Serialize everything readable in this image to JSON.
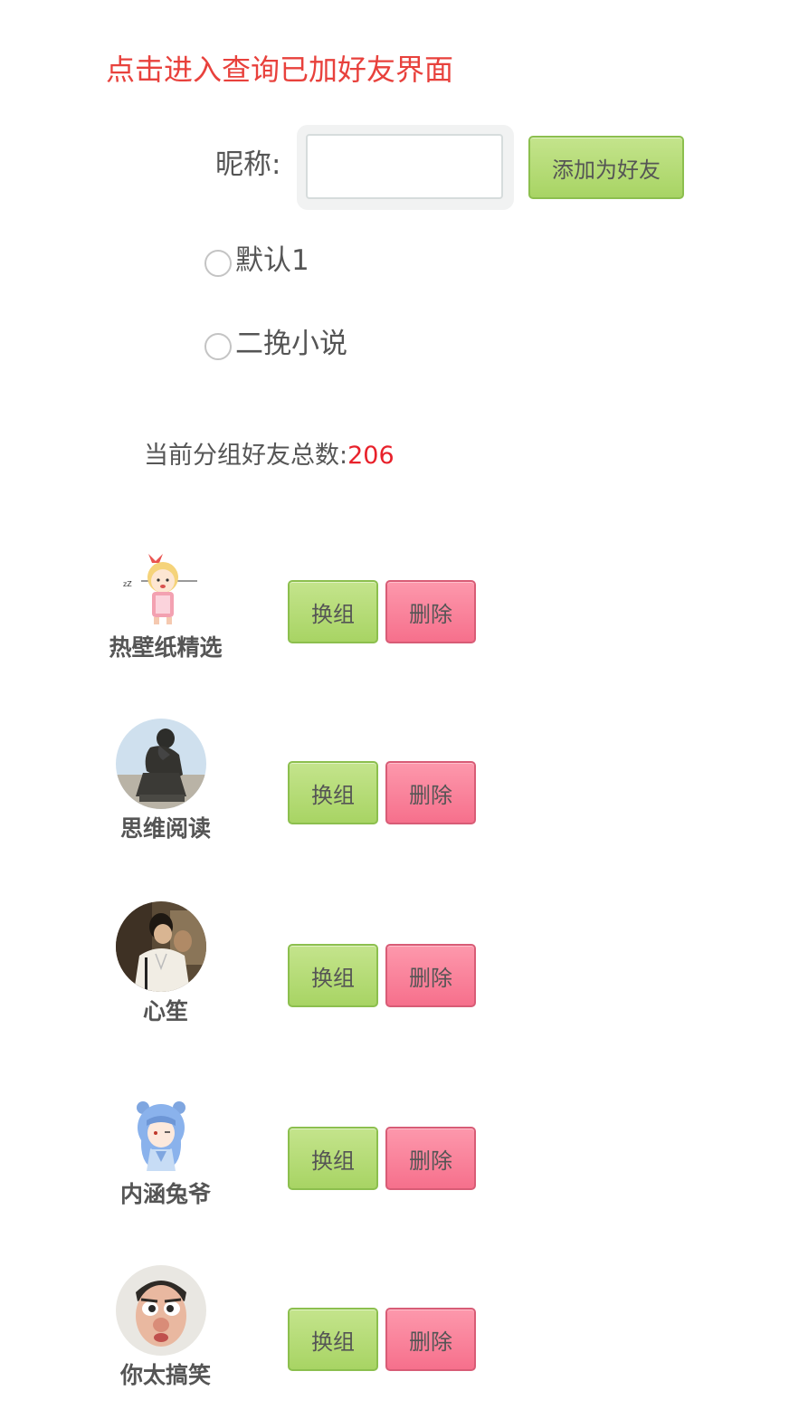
{
  "header": {
    "query_link": "点击进入查询已加好友界面"
  },
  "add_form": {
    "nickname_label": "昵称:",
    "nickname_value": "",
    "add_button": "添加为好友"
  },
  "groups": [
    {
      "label": "默认1",
      "selected": false
    },
    {
      "label": "二挽小说",
      "selected": false
    }
  ],
  "summary": {
    "label": "当前分组好友总数:",
    "count": "206"
  },
  "friends": [
    {
      "name": "热壁纸精选",
      "change_label": "换组",
      "delete_label": "删除",
      "avatar_icon": "anime-girl-avatar"
    },
    {
      "name": "思维阅读",
      "change_label": "换组",
      "delete_label": "删除",
      "avatar_icon": "thinker-statue-avatar"
    },
    {
      "name": "心笙",
      "change_label": "换组",
      "delete_label": "删除",
      "avatar_icon": "couple-photo-avatar"
    },
    {
      "name": "内涵兔爷",
      "change_label": "换组",
      "delete_label": "删除",
      "avatar_icon": "blue-hair-girl-avatar"
    },
    {
      "name": "你太搞笑",
      "change_label": "换组",
      "delete_label": "删除",
      "avatar_icon": "caricature-face-avatar"
    }
  ],
  "colors": {
    "link_red": "#e8413c",
    "count_red": "#e8212b",
    "button_green": "#b2d973",
    "button_pink": "#f8809a"
  }
}
